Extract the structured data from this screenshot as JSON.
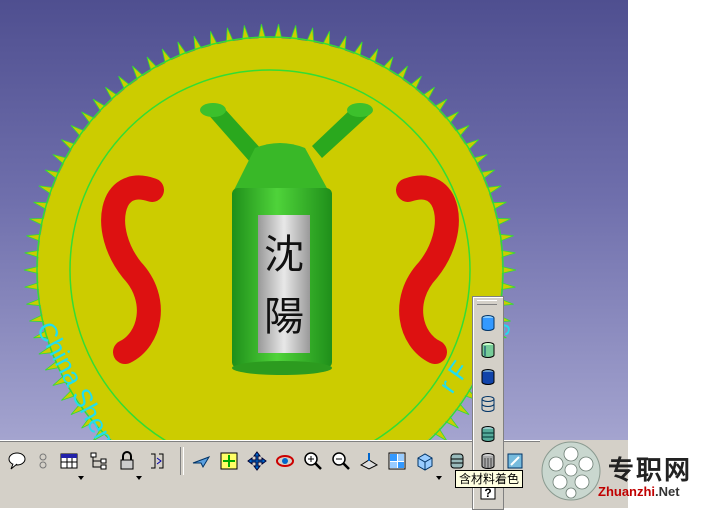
{
  "scene": {
    "rim_text": "China Shen",
    "rim_text_right": "r F",
    "rim_text_far_right": "g",
    "label_text": "沈陽",
    "colors": {
      "gear": "#cccc00",
      "rim_line": "#33dd33",
      "bottle": "#33bb22",
      "squiggle": "#dd1111",
      "rim_text": "#22ddee"
    }
  },
  "toolbar": {
    "icons": [
      "speech-bubble-icon",
      "zoom-step-icon",
      "table-icon",
      "tree-icon",
      "lock-icon",
      "fit-icon",
      "fly-icon",
      "fit-all-icon",
      "pan-icon",
      "rotate-icon",
      "zoom-in-icon",
      "zoom-out-icon",
      "normal-view-icon",
      "multi-view-icon",
      "iso-view-icon",
      "shading-icon",
      "material-icon"
    ]
  },
  "palette": {
    "icons": [
      "shading-blue-icon",
      "shading-edges-icon",
      "shading-dark-icon",
      "wireframe-icon",
      "material-cylinder-icon",
      "customize-icon",
      "help-icon"
    ]
  },
  "tooltip": {
    "text": "含材料着色"
  },
  "watermark": {
    "cn": "专职网",
    "en_main": "Zhuanzhi",
    "en_suffix": ".Net"
  }
}
